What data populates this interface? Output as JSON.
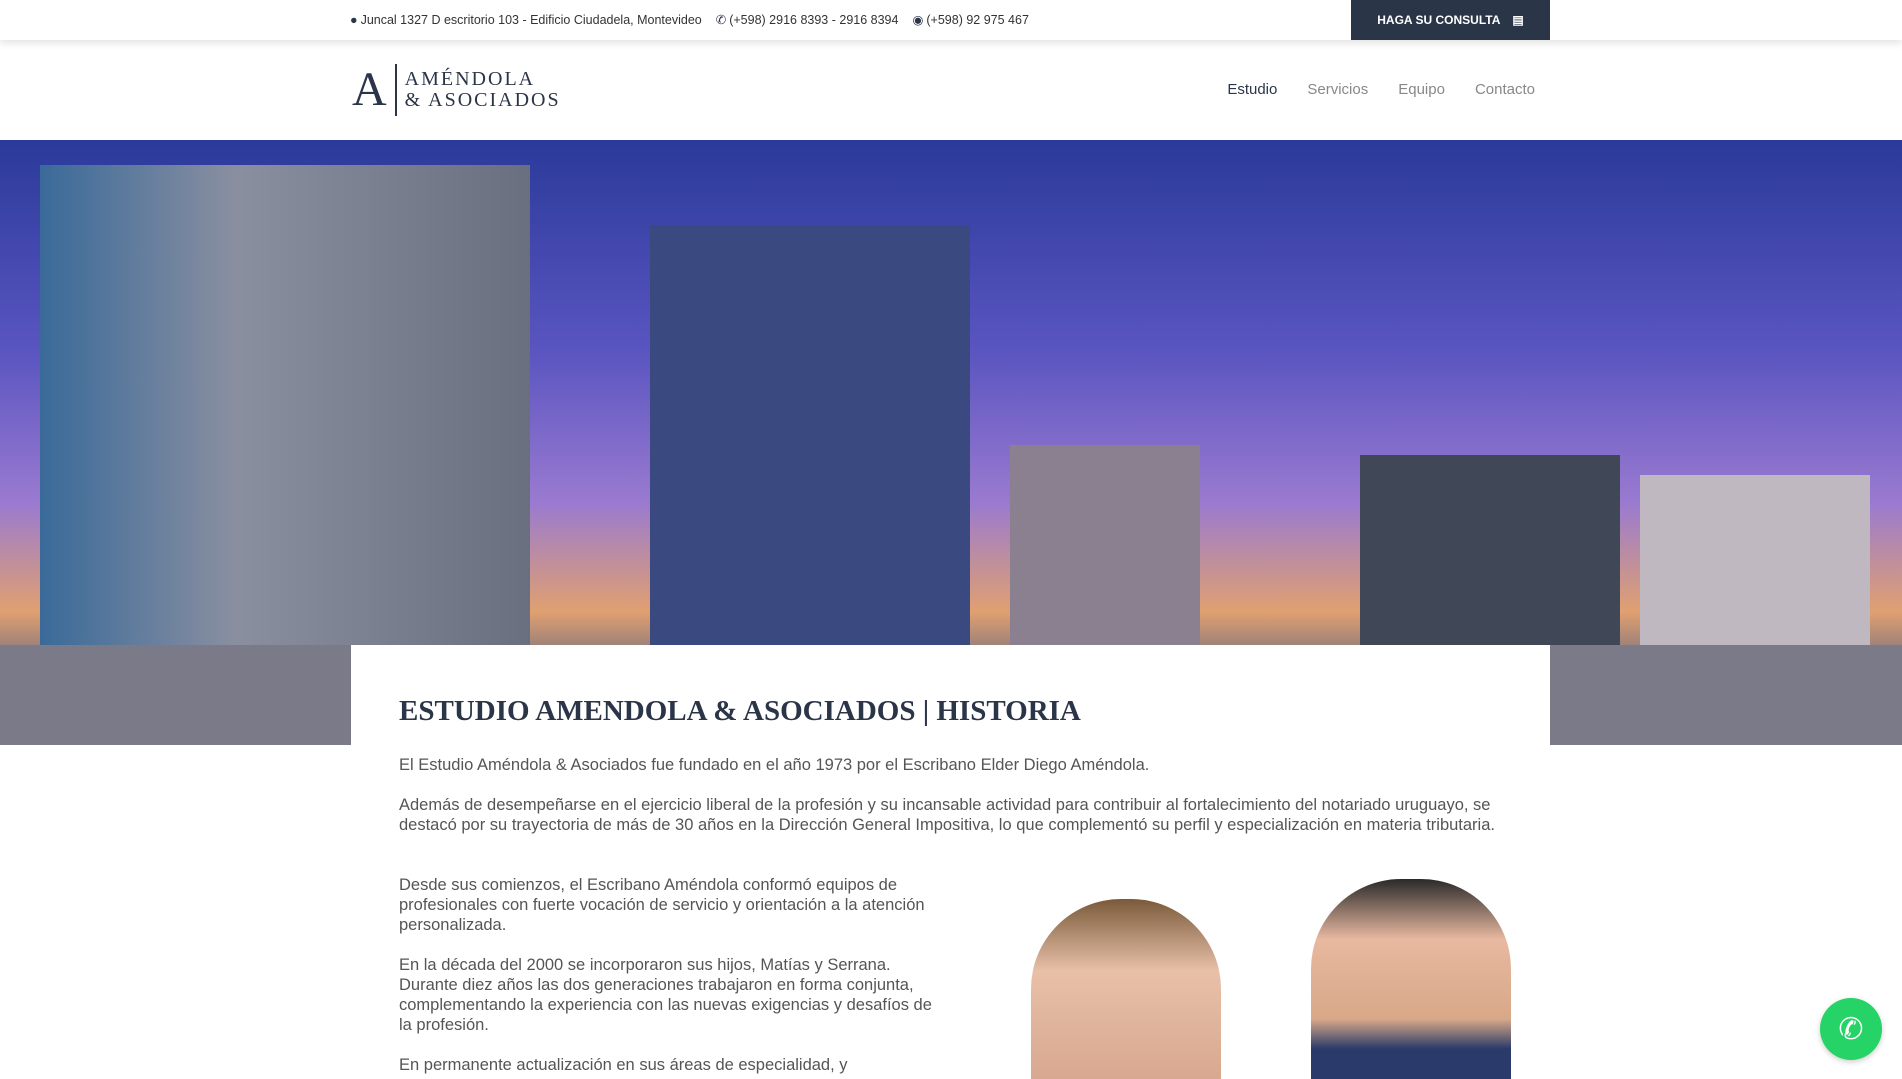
{
  "topbar": {
    "address": "Juncal 1327 D escritorio 103 - Edificio Ciudadela, Montevideo",
    "phone": "(+598) 2916 8393 - 2916 8394",
    "whatsapp": "(+598) 92 975 467",
    "cta": "HAGA SU CONSULTA"
  },
  "logo": {
    "letter": "A",
    "line1": "AMÉNDOLA",
    "line2": "& ASOCIADOS"
  },
  "nav": [
    "Estudio",
    "Servicios",
    "Equipo",
    "Contacto"
  ],
  "content": {
    "title": "ESTUDIO AMENDOLA & ASOCIADOS | HISTORIA",
    "paragraphs": [
      "El Estudio Améndola & Asociados fue fundado en el año 1973 por el Escribano Elder Diego Améndola.",
      "Además de desempeñarse en el ejercicio liberal de la profesión y su incansable actividad para contribuir al fortalecimiento del notariado uruguayo, se destacó por su trayectoria de más de 30 años en la Dirección General Impositiva, lo que complementó su perfil y especialización en materia tributaria.",
      "Desde sus comienzos, el Escribano Améndola conformó equipos de profesionales con fuerte vocación de servicio y orientación a la atención personalizada.",
      "En la década del 2000 se incorporaron sus hijos, Matías y Serrana. Durante diez años las dos generaciones trabajaron en forma conjunta, complementando la experiencia con las nuevas exigencias y desafíos de la profesión.",
      "En permanente actualización en sus áreas de especialidad, y"
    ]
  },
  "colors": {
    "brand": "#2b3548",
    "whatsapp": "#25d366"
  }
}
